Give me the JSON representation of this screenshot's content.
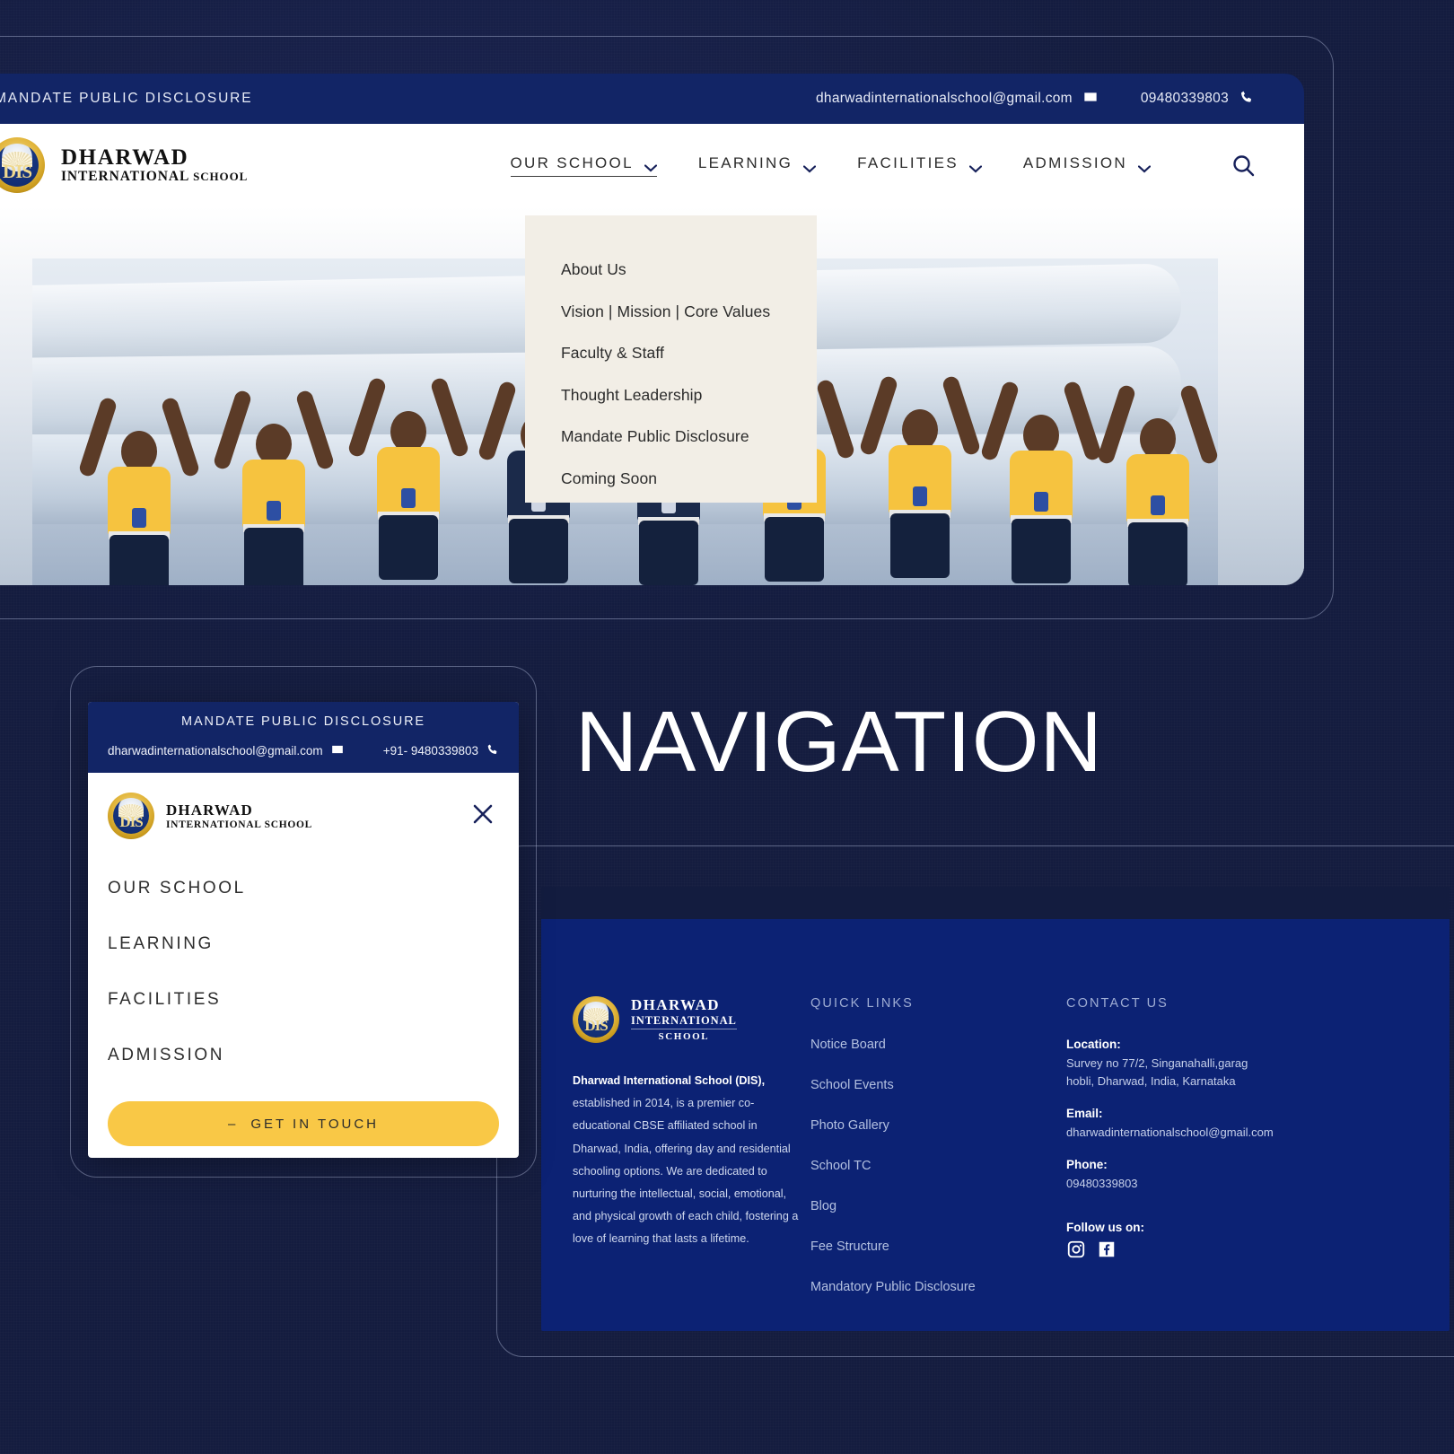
{
  "page": {
    "section_heading": "NAVIGATION",
    "accent_navy": "#0c2274",
    "accent_dark": "#131b3d",
    "accent_yellow": "#f9c846",
    "dropdown_bg": "#f2eee6"
  },
  "desktop": {
    "utility": {
      "disclosure_label": "MANDATE PUBLIC DISCLOSURE",
      "email": "dharwadinternationalschool@gmail.com",
      "phone": "09480339803"
    },
    "brand": {
      "line1": "DHARWAD",
      "line2_main": "INTERNATIONAL",
      "line2_small": "SCHOOL",
      "logo_text": "DIS"
    },
    "nav": [
      {
        "label": "OUR SCHOOL",
        "active": true
      },
      {
        "label": "LEARNING",
        "active": false
      },
      {
        "label": "FACILITIES",
        "active": false
      },
      {
        "label": "ADMISSION",
        "active": false
      }
    ],
    "search_icon": "search-icon",
    "dropdown": {
      "items": [
        "About Us",
        "Vision |  Mission | Core Values",
        "Faculty & Staff",
        "Thought Leadership",
        "Mandate Public Disclosure",
        "Coming Soon"
      ]
    }
  },
  "mobile": {
    "utility": {
      "disclosure_label": "MANDATE PUBLIC DISCLOSURE",
      "email": "dharwadinternationalschool@gmail.com",
      "phone": "+91- 9480339803"
    },
    "brand": {
      "line1": "DHARWAD",
      "line2": "INTERNATIONAL SCHOOL",
      "logo_text": "DIS"
    },
    "close_icon": "close-icon",
    "links": [
      "OUR SCHOOL",
      "LEARNING",
      "FACILITIES",
      "ADMISSION"
    ],
    "cta": {
      "dash": "–",
      "label": "GET IN TOUCH"
    }
  },
  "footer": {
    "brand": {
      "line1": "DHARWAD",
      "line2": "INTERNATIONAL",
      "line3": "SCHOOL",
      "logo_text": "DIS"
    },
    "about_bold": "Dharwad International School (DIS),",
    "about_text": " established in 2014, is a premier co-educational CBSE affiliated school in Dharwad, India, offering day and residential schooling options. We are dedicated to nurturing the intellectual, social, emotional, and physical growth of each child, fostering a love of learning that lasts a lifetime.",
    "quick_links": {
      "heading": "QUICK LINKS",
      "items": [
        "Notice Board",
        "School Events",
        "Photo Gallery",
        "School TC",
        "Blog",
        "Fee Structure",
        "Mandatory Public Disclosure"
      ]
    },
    "contact": {
      "heading": "CONTACT US",
      "location_label": "Location:",
      "location_value": "Survey no 77/2, Singanahalli,garag hobli, Dharwad, India, Karnataka",
      "email_label": "Email:",
      "email_value": "dharwadinternationalschool@gmail.com",
      "phone_label": "Phone:",
      "phone_value": "09480339803",
      "follow_label": "Follow us on:",
      "social": [
        "instagram-icon",
        "facebook-icon"
      ]
    }
  }
}
